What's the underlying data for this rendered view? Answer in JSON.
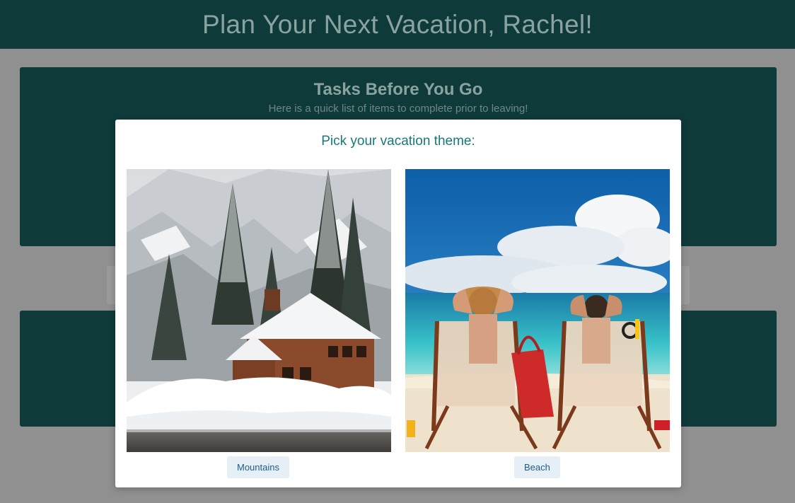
{
  "header": {
    "title": "Plan Your Next Vacation, Rachel!"
  },
  "tasks": {
    "title": "Tasks Before You Go",
    "subtitle": "Here is a quick list of items to complete prior to leaving!"
  },
  "modal": {
    "title": "Pick your vacation theme:",
    "options": [
      {
        "label": "Mountains",
        "image": "snowy mountain cabin"
      },
      {
        "label": "Beach",
        "image": "couple on beach loungers"
      }
    ]
  },
  "colors": {
    "header_bg": "#0f3a3a",
    "modal_title": "#167a78",
    "button_bg": "#e6eff6",
    "button_text": "#1f5b8a"
  }
}
